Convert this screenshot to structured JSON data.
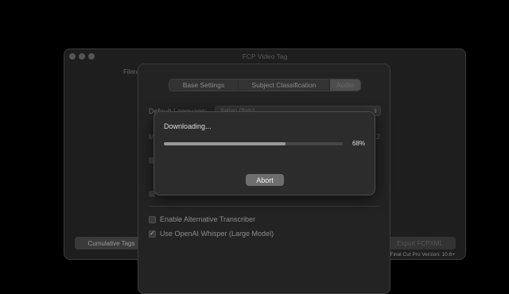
{
  "window": {
    "title": "FCP Video Tag"
  },
  "main": {
    "filename_label": "Filena",
    "cumulative_tags_button": "Cumulative Tags",
    "export_button": "Export FCPXML",
    "version_text": "Final Cut Pro Version: 10.6+"
  },
  "settings": {
    "tabs": [
      {
        "label": "Base Settings"
      },
      {
        "label": "Subject Classification"
      },
      {
        "label": "Audio",
        "selected": true
      }
    ],
    "default_language_label": "Default Language:",
    "default_language_value": "Italian (Italy)",
    "model_label": "M",
    "model_value_partial": "2",
    "checkboxes": [
      {
        "label": "Enable Alternative Transcriber",
        "checked": false
      },
      {
        "label": "Use OpenAI Whisper (Large Model)",
        "checked": true
      }
    ]
  },
  "download_dialog": {
    "title": "Downloading...",
    "progress": 0.68,
    "progress_text": "68%",
    "abort_button": "Abort"
  },
  "icons": {
    "checkmark": "checkmark-icon",
    "select_arrows": "chevron-updown-icon",
    "window_controls": "traffic-light-buttons"
  }
}
